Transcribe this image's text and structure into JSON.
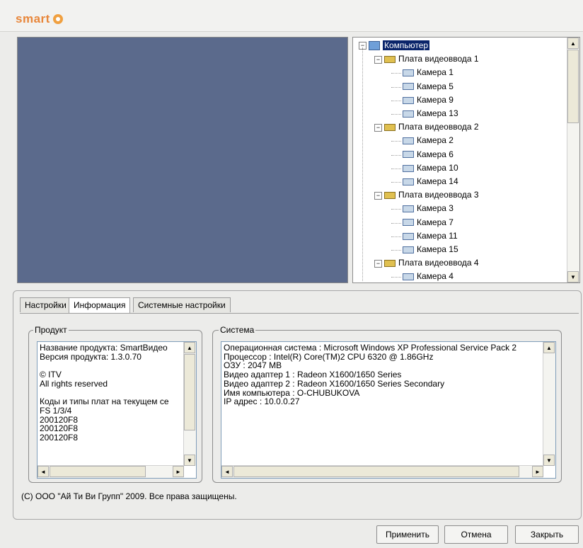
{
  "app": {
    "logo_text": "smart"
  },
  "tree": {
    "root": "Компьютер",
    "boards": [
      {
        "label": "Плата видеоввода 1",
        "cameras": [
          "Камера 1",
          "Камера 5",
          "Камера 9",
          "Камера 13"
        ]
      },
      {
        "label": "Плата видеоввода 2",
        "cameras": [
          "Камера 2",
          "Камера 6",
          "Камера 10",
          "Камера 14"
        ]
      },
      {
        "label": "Плата видеоввода 3",
        "cameras": [
          "Камера 3",
          "Камера 7",
          "Камера 11",
          "Камера 15"
        ]
      },
      {
        "label": "Плата видеоввода 4",
        "cameras": [
          "Камера 4"
        ]
      }
    ]
  },
  "tabs": [
    {
      "label": "Настройки"
    },
    {
      "label": "Информация"
    },
    {
      "label": "Системные настройки"
    }
  ],
  "product": {
    "title": "Продукт",
    "lines": [
      "Название продукта: SmartВидео",
      "Версия продукта: 1.3.0.70",
      "",
      "© ITV",
      "All rights reserved",
      "",
      "Коды и типы плат на текущем се",
      "FS 1/3/4",
      "200120F8",
      "200120F8",
      "200120F8"
    ]
  },
  "system": {
    "title": "Система",
    "lines": [
      "Операционная система : Microsoft Windows XP Professional Service Pack 2",
      "Процессор : Intel(R) Core(TM)2 CPU         6320  @ 1.86GHz",
      "ОЗУ : 2047 MB",
      "Видео адаптер 1 : Radeon X1600/1650 Series",
      "Видео адаптер 2 : Radeon X1600/1650 Series Secondary",
      "Имя компьютера : O-CHUBUKOVA",
      "IP адрес : 10.0.0.27"
    ]
  },
  "copyright": "(C) ООО \"Ай Ти Ви Групп\" 2009. Все права защищены.",
  "buttons": {
    "apply": "Применить",
    "cancel": "Отмена",
    "close": "Закрыть"
  }
}
